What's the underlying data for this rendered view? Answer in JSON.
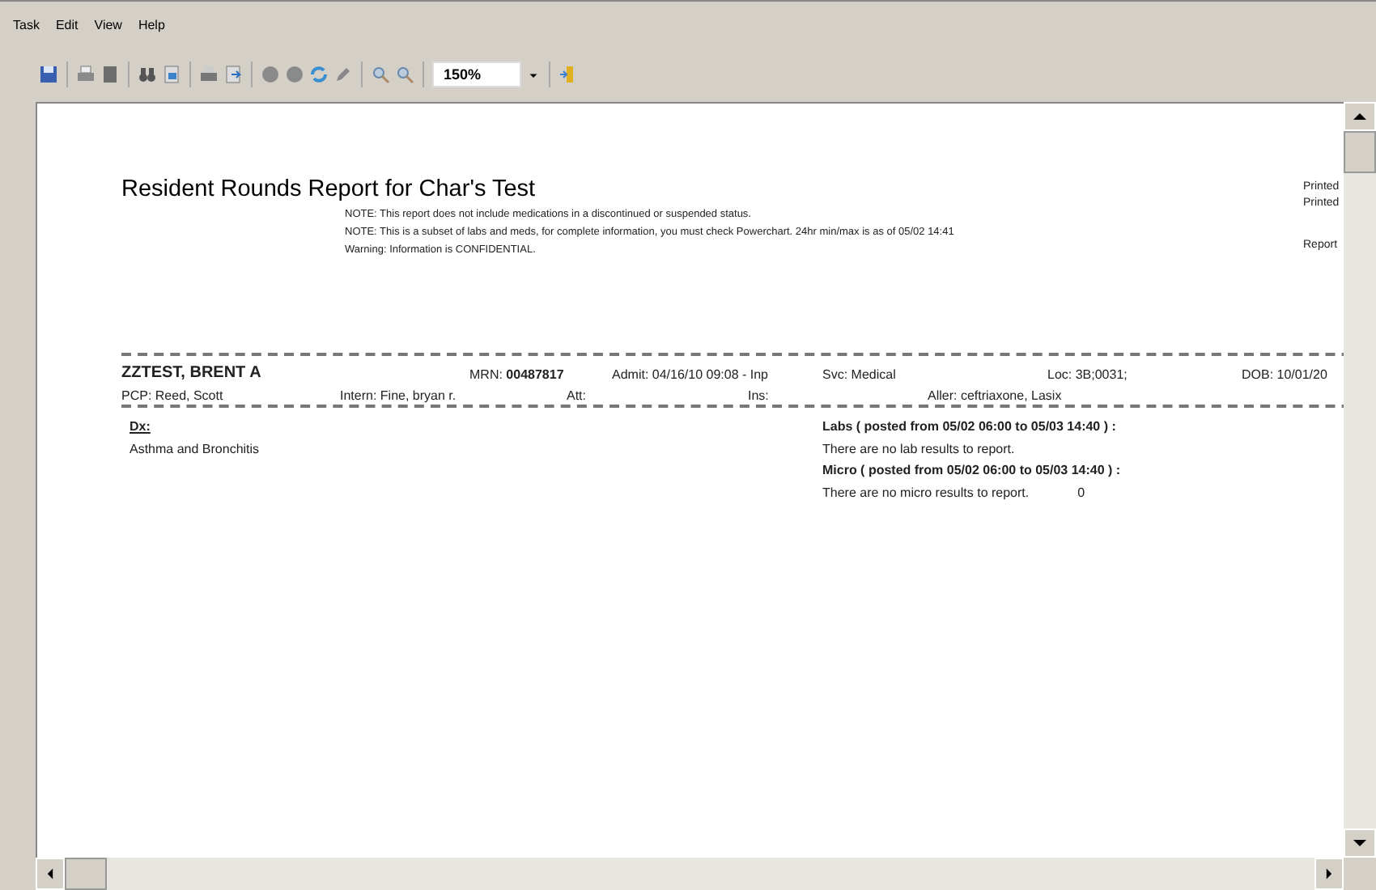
{
  "menu": [
    "Task",
    "Edit",
    "View",
    "Help"
  ],
  "toolbar": {
    "zoom": "150%"
  },
  "report": {
    "title": "Resident Rounds Report for Char's Test",
    "notes": [
      "NOTE:  This report does not include medications in a discontinued or suspended status.",
      "NOTE:  This is  a subset  of labs  and meds, for complete information, you must  check Powerchart.  24hr min/max is  as of 05/02 14:41",
      "Warning: Information is CONFIDENTIAL."
    ],
    "right_labels": [
      "Printed",
      "Printed",
      "Report"
    ],
    "patient": {
      "name": "ZZTEST, BRENT A",
      "mrn": "MRN: **00487817**",
      "admit": "Admit: 04/16/10 09:08 - Inp",
      "svc": "Svc: Medical",
      "loc": "Loc: 3B;0031;",
      "dob": "DOB: 10/01/20",
      "pcp": "PCP: Reed, Scott",
      "intern": "Intern: Fine, bryan r.",
      "att": "Att:",
      "ins": "Ins:",
      "aller": "Aller: ceftriaxone, Lasix"
    },
    "dx": {
      "heading": "Dx:",
      "text": "Asthma and Bronchitis"
    },
    "labs": {
      "heading": "Labs ( posted from 05/02 06:00 to 05/03 14:40 ) :",
      "text": "There are no lab results to report."
    },
    "micro": {
      "heading": "Micro ( posted from 05/02 06:00 to 05/03 14:40 ) :",
      "text": "There are no micro results to report.",
      "count": "0"
    }
  }
}
